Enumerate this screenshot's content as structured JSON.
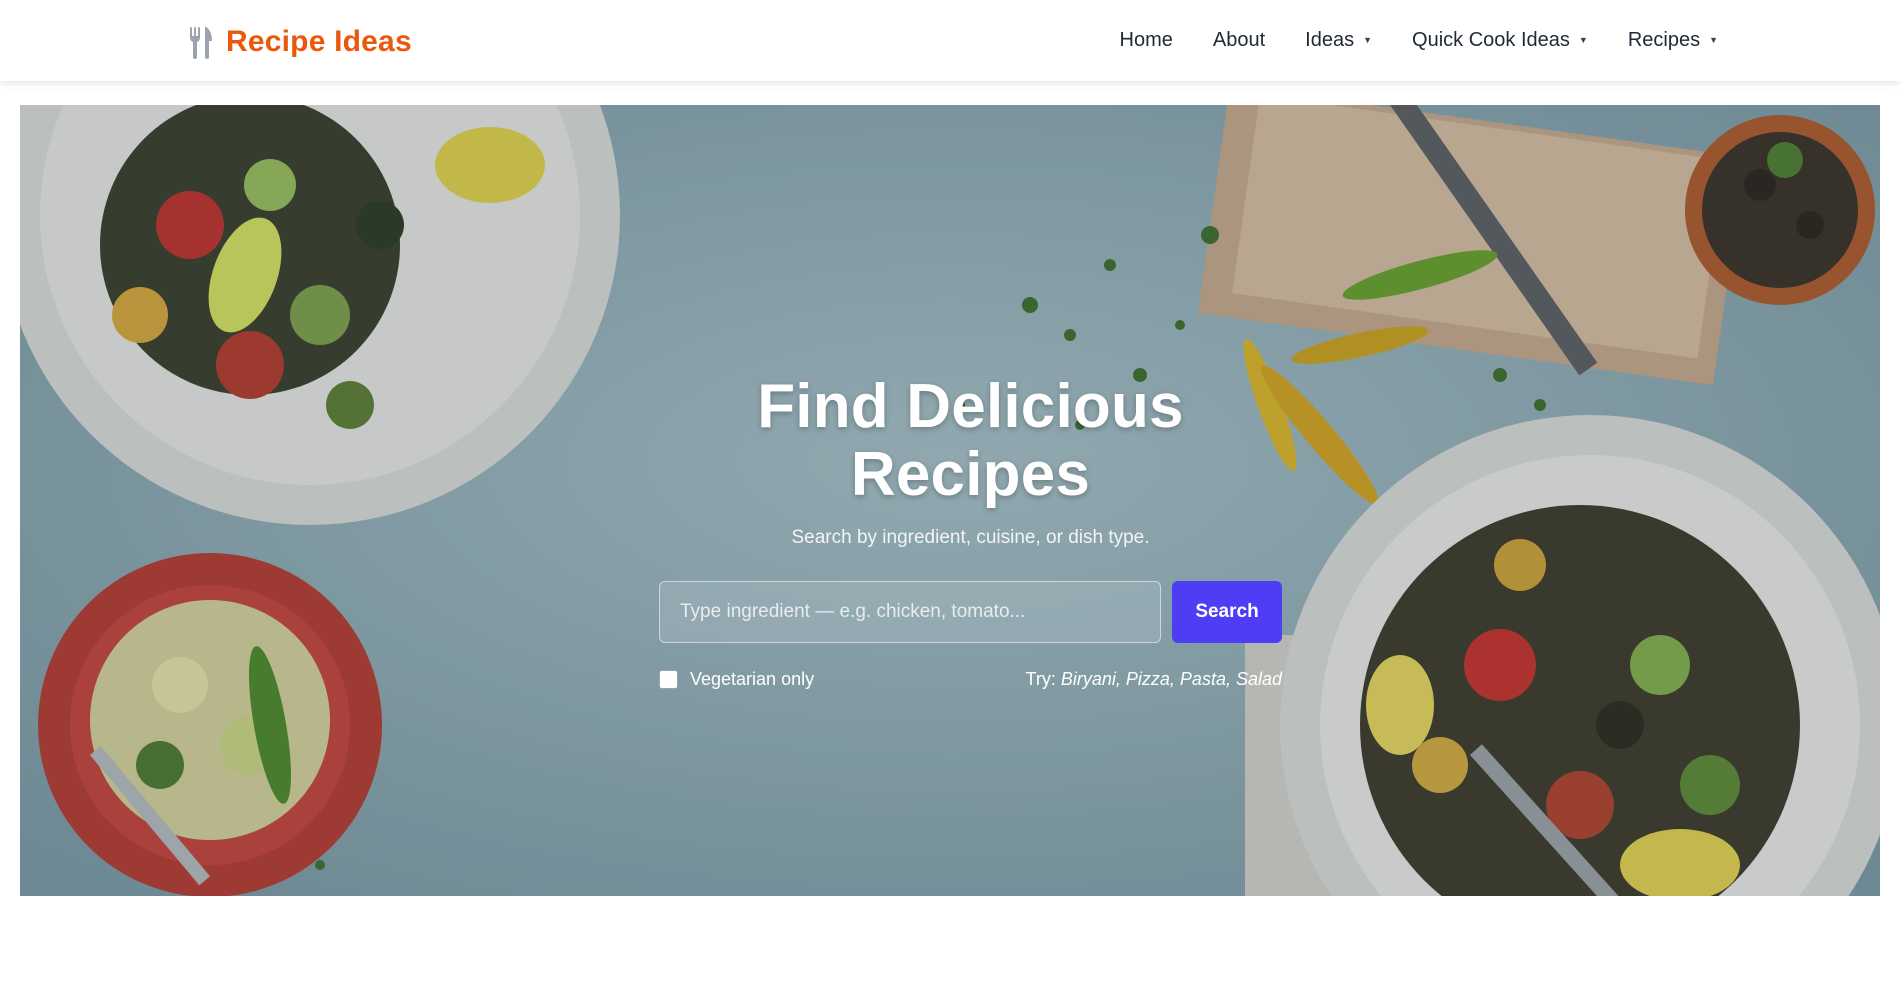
{
  "header": {
    "brand": {
      "name": "Recipe Ideas",
      "icon": "fork-knife-icon",
      "color": "#ea580c"
    },
    "nav": [
      {
        "label": "Home",
        "has_dropdown": false
      },
      {
        "label": "About",
        "has_dropdown": false
      },
      {
        "label": "Ideas",
        "has_dropdown": true
      },
      {
        "label": "Quick Cook Ideas",
        "has_dropdown": true
      },
      {
        "label": "Recipes",
        "has_dropdown": true
      }
    ]
  },
  "hero": {
    "title": "Find Delicious Recipes",
    "subtitle": "Search by ingredient, cuisine, or dish type.",
    "search": {
      "placeholder": "Type ingredient — e.g. chicken, tomato...",
      "value": "",
      "button_label": "Search",
      "button_color": "#4f3df5"
    },
    "vegetarian": {
      "label": "Vegetarian only",
      "checked": false
    },
    "suggestions": {
      "prefix": "Try:",
      "items": "Biryani, Pizza, Pasta, Salad"
    }
  }
}
